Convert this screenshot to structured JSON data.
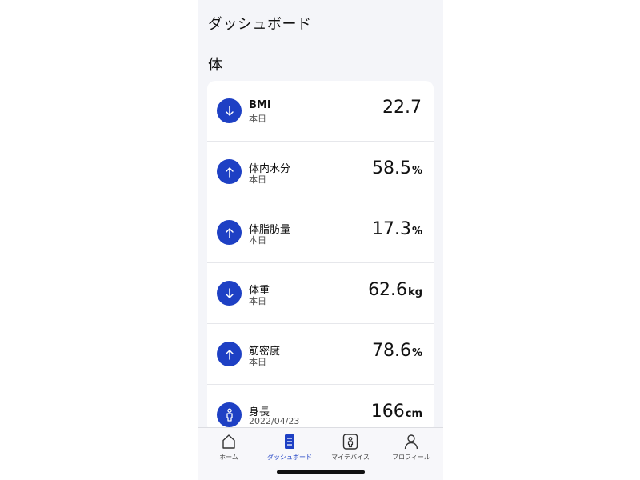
{
  "header": {
    "title": "ダッシュボード"
  },
  "section": {
    "title": "体"
  },
  "metrics": [
    {
      "label": "BMI",
      "sub": "本日",
      "value": "22.7",
      "unit": "",
      "icon": "arrow-down-icon"
    },
    {
      "label": "体内水分",
      "sub": "本日",
      "value": "58.5",
      "unit": "%",
      "icon": "arrow-up-icon"
    },
    {
      "label": "体脂肪量",
      "sub": "本日",
      "value": "17.3",
      "unit": "%",
      "icon": "arrow-up-icon"
    },
    {
      "label": "体重",
      "sub": "本日",
      "value": "62.6",
      "unit": "kg",
      "icon": "arrow-down-icon"
    },
    {
      "label": "筋密度",
      "sub": "本日",
      "value": "78.6",
      "unit": "%",
      "icon": "arrow-up-icon"
    },
    {
      "label": "身長",
      "sub": "2022/04/23",
      "value": "166",
      "unit": "cm",
      "icon": "person-icon"
    }
  ],
  "tabs": [
    {
      "label": "ホーム",
      "icon": "home-icon",
      "active": false
    },
    {
      "label": "ダッシュボード",
      "icon": "dashboard-icon",
      "active": true
    },
    {
      "label": "マイデバイス",
      "icon": "device-icon",
      "active": false
    },
    {
      "label": "プロフィール",
      "icon": "profile-icon",
      "active": false
    }
  ],
  "colors": {
    "accent": "#1e40c4",
    "background": "#f4f5f9",
    "card": "#ffffff"
  }
}
